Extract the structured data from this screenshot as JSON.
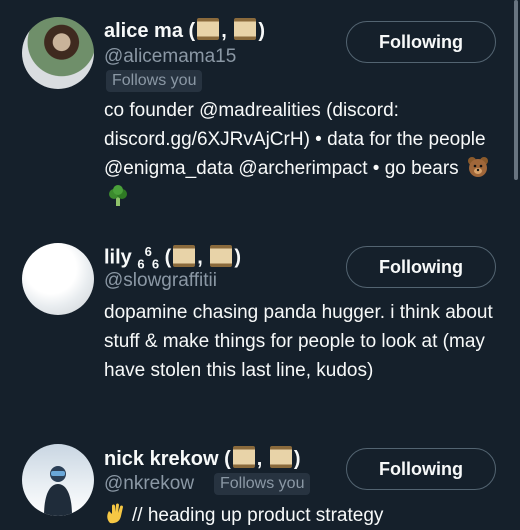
{
  "users": [
    {
      "name": "alice ma",
      "name_suffix_open": "(",
      "name_suffix_sep": ",",
      "name_suffix_close": ")",
      "handle": "@alicemama15",
      "follows_you": "Follows you",
      "follow_button": "Following",
      "bio": "co founder @madrealities (discord: discord.gg/6XJRvAjCrH) • data for the people @enigma_data @archerimpact • go bears",
      "bio_emoji": [
        "bear-face-icon",
        "broccoli-icon"
      ]
    },
    {
      "name": "lily",
      "name_sub1": "6",
      "name_sup": "6",
      "name_sub2": "6",
      "name_suffix_open": "(",
      "name_suffix_sep": ",",
      "name_suffix_close": ")",
      "handle": "@slowgraffitii",
      "follow_button": "Following",
      "bio": "dopamine chasing panda hugger. i think about stuff & make things for people to look at (may have stolen this last line, kudos)"
    },
    {
      "name": "nick krekow",
      "name_suffix_open": "(",
      "name_suffix_sep": ",",
      "name_suffix_close": ")",
      "handle": "@nkrekow",
      "follows_you": "Follows you",
      "follow_button": "Following",
      "bio": "// heading up product strategy",
      "bio_emoji": [
        "waving-hand-icon"
      ]
    }
  ],
  "colors": {
    "background": "#15202b",
    "primary_text": "#f7f9f9",
    "secondary_text": "#8b98a5",
    "button_border": "#536471"
  }
}
